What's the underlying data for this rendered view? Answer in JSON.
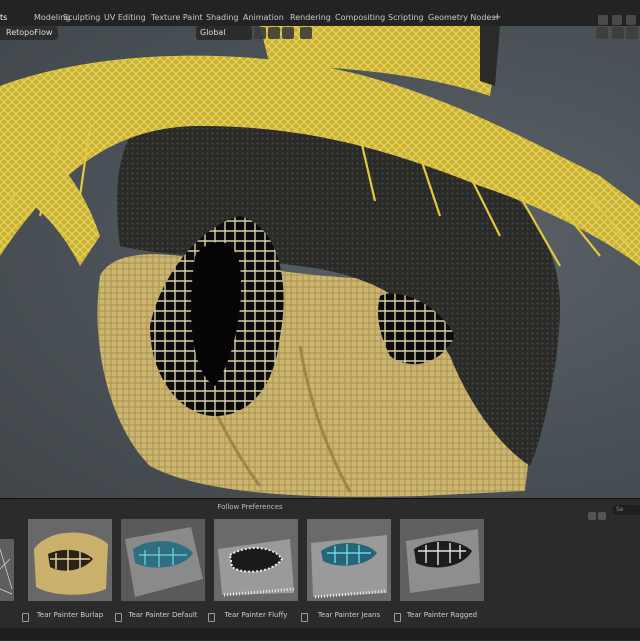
{
  "workspace_tabs": [
    {
      "label": "ts",
      "active": true
    },
    {
      "label": "Modeling",
      "active": false
    },
    {
      "label": "Sculpting",
      "active": false
    },
    {
      "label": "UV Editing",
      "active": false
    },
    {
      "label": "Texture Paint",
      "active": false
    },
    {
      "label": "Shading",
      "active": false
    },
    {
      "label": "Animation",
      "active": false
    },
    {
      "label": "Rendering",
      "active": false
    },
    {
      "label": "Compositing",
      "active": false
    },
    {
      "label": "Scripting",
      "active": false
    },
    {
      "label": "Geometry Nodes",
      "active": false
    }
  ],
  "add_tab_label": "+",
  "viewport": {
    "object_name": "RetopoFlow",
    "transform_orientation": "Global"
  },
  "asset_panel": {
    "title": "Follow Preferences",
    "search_placeholder": "Se",
    "assets": [
      {
        "label": "Tear Painter Burlap"
      },
      {
        "label": "Tear Painter Default"
      },
      {
        "label": "Tear Painter Fluffy"
      },
      {
        "label": "Tear Painter Jeans"
      },
      {
        "label": "Tear Painter Ragged"
      }
    ]
  },
  "colors": {
    "burlap": "#d8c27a",
    "straw": "#e6cf4a",
    "viewport_bg": "#4b5257",
    "jeans_blue": "#4fb3c4"
  }
}
